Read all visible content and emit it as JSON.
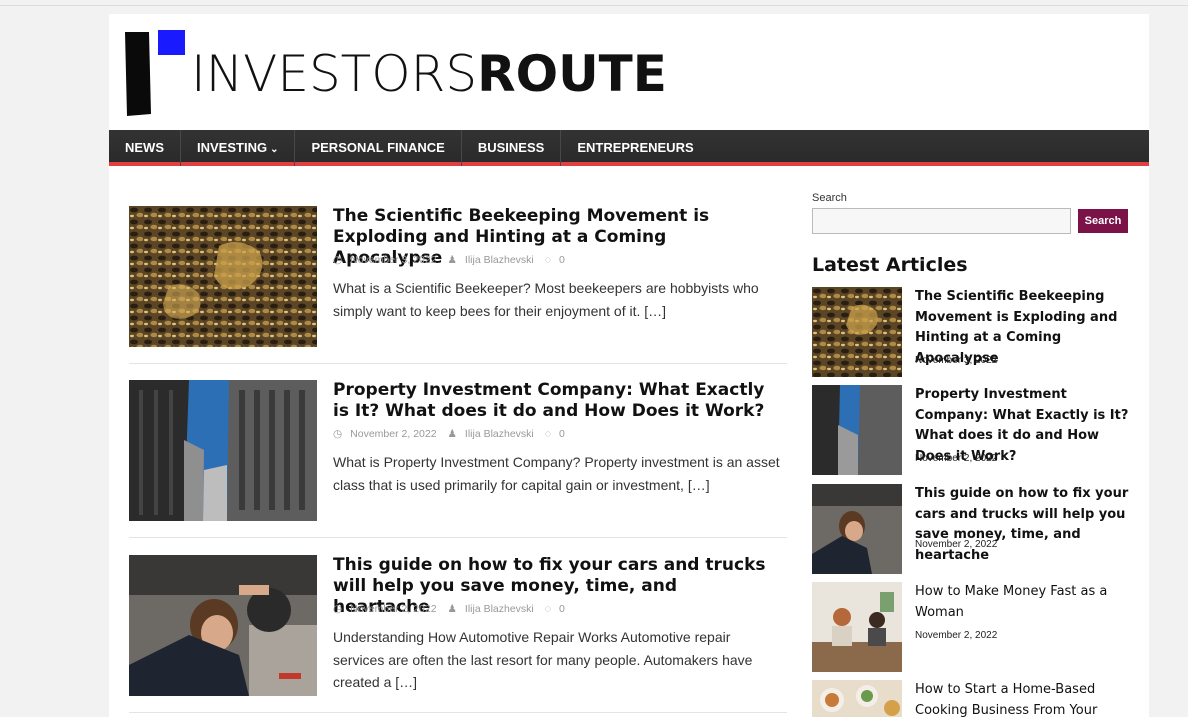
{
  "brand": {
    "logo_thin": "INVESTORS",
    "logo_bold": "ROUTE",
    "accent": "#1a1aff"
  },
  "nav": {
    "items": [
      {
        "label": "NEWS"
      },
      {
        "label": "INVESTING",
        "has_dropdown": true
      },
      {
        "label": "PERSONAL FINANCE"
      },
      {
        "label": "BUSINESS"
      },
      {
        "label": "ENTREPRENEURS"
      }
    ],
    "underline_color": "#e04040"
  },
  "posts": [
    {
      "title": "The Scientific Beekeeping Movement is Exploding and Hinting at a Coming Apocalypse",
      "date": "November 3, 2022",
      "author": "Ilija Blazhevski",
      "comments": "0",
      "excerpt": "What is a Scientific Beekeeper? Most beekeepers are hobbyists who simply want to keep bees for their enjoyment of it.",
      "more": "[…]",
      "image": "bees-honeycomb"
    },
    {
      "title": "Property Investment Company: What Exactly is It? What does it do and How Does it Work?",
      "date": "November 2, 2022",
      "author": "Ilija Blazhevski",
      "comments": "0",
      "excerpt": "What is Property Investment Company? Property investment is an asset class that is used primarily for capital gain or investment,",
      "more": "[…]",
      "image": "skyscrapers"
    },
    {
      "title": "This guide on how to fix your cars and trucks will help you save money, time, and heartache",
      "date": "November 2, 2022",
      "author": "Ilija Blazhevski",
      "comments": "0",
      "excerpt": "Understanding How Automotive Repair Works Automotive repair services are often the last resort for many people. Automakers have created a",
      "more": "[…]",
      "image": "mechanic-under-car"
    }
  ],
  "sidebar": {
    "search_label": "Search",
    "search_value": "",
    "search_button": "Search",
    "search_button_color": "#7b1248",
    "latest_heading": "Latest Articles",
    "latest": [
      {
        "title": "The Scientific Beekeeping Movement is Exploding and Hinting at a Coming Apocalypse",
        "date": "November 3, 2022",
        "image": "bees-honeycomb"
      },
      {
        "title": "Property Investment Company: What Exactly is It? What does it do and How Does it Work?",
        "date": "November 2, 2022",
        "image": "skyscrapers"
      },
      {
        "title": "This guide on how to fix your cars and trucks will help you save money, time, and heartache",
        "date": "November 2, 2022",
        "image": "mechanic-under-car"
      },
      {
        "title": "How to Make Money Fast as a Woman",
        "date": "November 2, 2022",
        "image": "women-at-table"
      },
      {
        "title": "How to Start a Home-Based Cooking Business From Your",
        "date": "",
        "image": "food-dishes"
      }
    ]
  }
}
